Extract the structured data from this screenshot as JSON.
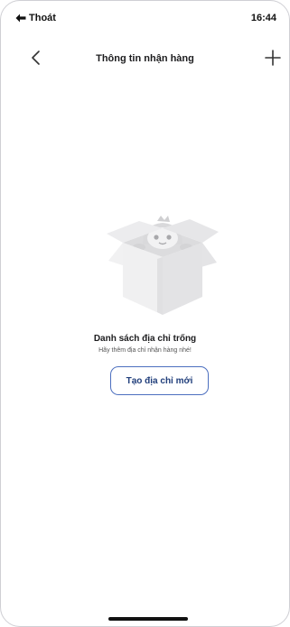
{
  "status_bar": {
    "back_app_label": "Thoát",
    "time": "16:44"
  },
  "header": {
    "title": "Thông tin nhận hàng",
    "back_icon": "chevron-left-icon",
    "add_icon": "plus-icon"
  },
  "empty_state": {
    "illustration": "mascot-in-open-box",
    "title": "Danh sách địa chỉ trống",
    "subtitle": "Hãy thêm địa chỉ nhận hàng nhé!",
    "button_label": "Tạo địa chỉ mới"
  },
  "colors": {
    "button_border": "#4c6fbf",
    "button_text": "#1f3d7a",
    "illustration_gray": "#e9e9ea"
  }
}
